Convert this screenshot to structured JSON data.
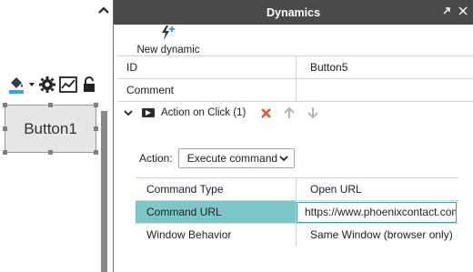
{
  "canvas": {
    "widget_label": "Button1",
    "toolbar_icons": [
      "fill-color-icon",
      "dropdown-arrow-icon",
      "gear-icon",
      "chart-icon",
      "lock-icon"
    ]
  },
  "panel": {
    "title": "Dynamics",
    "new_dynamic_label": "New dynamic",
    "properties": [
      {
        "label": "ID",
        "value": "Button5"
      },
      {
        "label": "Comment",
        "value": ""
      }
    ],
    "section": {
      "label": "Action on Click (1)"
    },
    "action": {
      "label": "Action:",
      "selected": "Execute command"
    },
    "command_table": [
      {
        "label": "Command Type",
        "value": "Open URL"
      },
      {
        "label": "Command URL",
        "value": "https://www.phoenixcontact.com"
      },
      {
        "label": "Window Behavior",
        "value": "Same Window (browser only)"
      }
    ]
  },
  "colors": {
    "titlebar": "#4a4a4a",
    "selected_row": "#7cc8c8",
    "delete_red": "#e8582a",
    "accent_teal": "#37a3a3"
  }
}
